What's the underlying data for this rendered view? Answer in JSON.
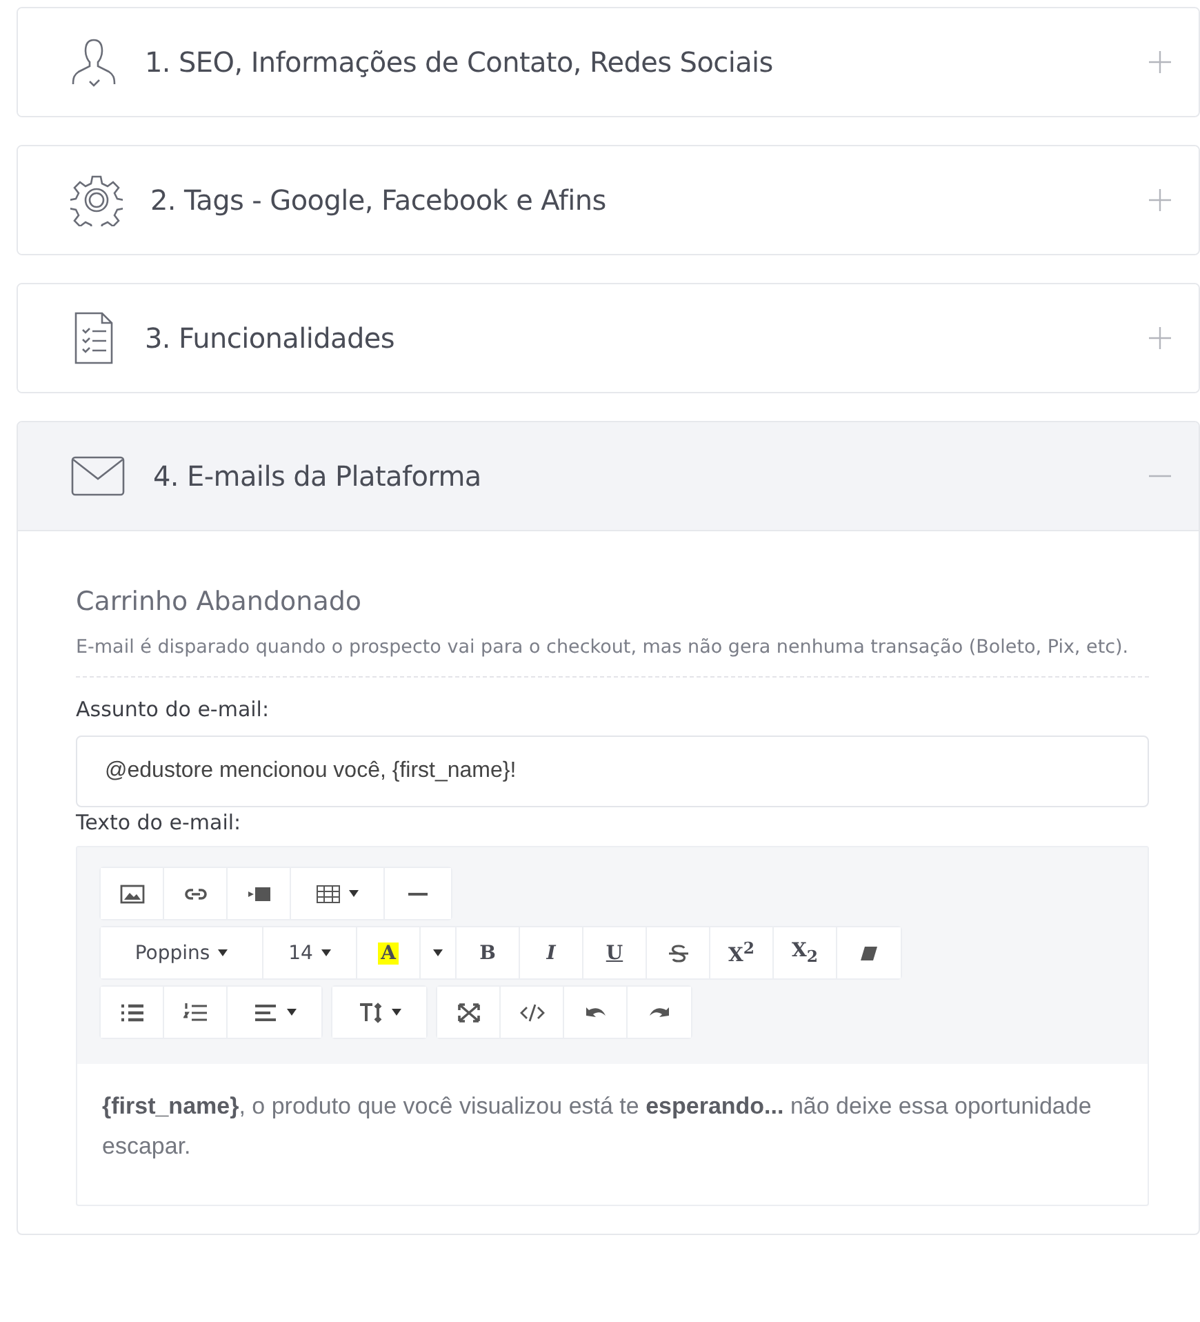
{
  "sections": [
    {
      "title": "1. SEO, Informações de Contato, Redes Sociais",
      "expanded": false
    },
    {
      "title": "2. Tags - Google, Facebook e Afins",
      "expanded": false
    },
    {
      "title": "3. Funcionalidades",
      "expanded": false
    },
    {
      "title": "4. E-mails da Plataforma",
      "expanded": true
    }
  ],
  "email": {
    "heading": "Carrinho Abandonado",
    "description": "E-mail é disparado quando o prospecto vai para o checkout, mas não gera nenhuma transação (Boleto, Pix, etc).",
    "subject_label": "Assunto do e-mail:",
    "subject_value": "@edustore mencionou você, {first_name}!",
    "body_label": "Texto do e-mail:",
    "toolbar": {
      "font": "Poppins",
      "size": "14",
      "format_buttons": [
        "A",
        "B",
        "I",
        "U",
        "X$^{2}$",
        "X$_{2}$"
      ]
    },
    "body_text": "**{first_name}**, o produto que você visualizou está te **esperando...** não deixe essa oportunidade escapar."
  }
}
